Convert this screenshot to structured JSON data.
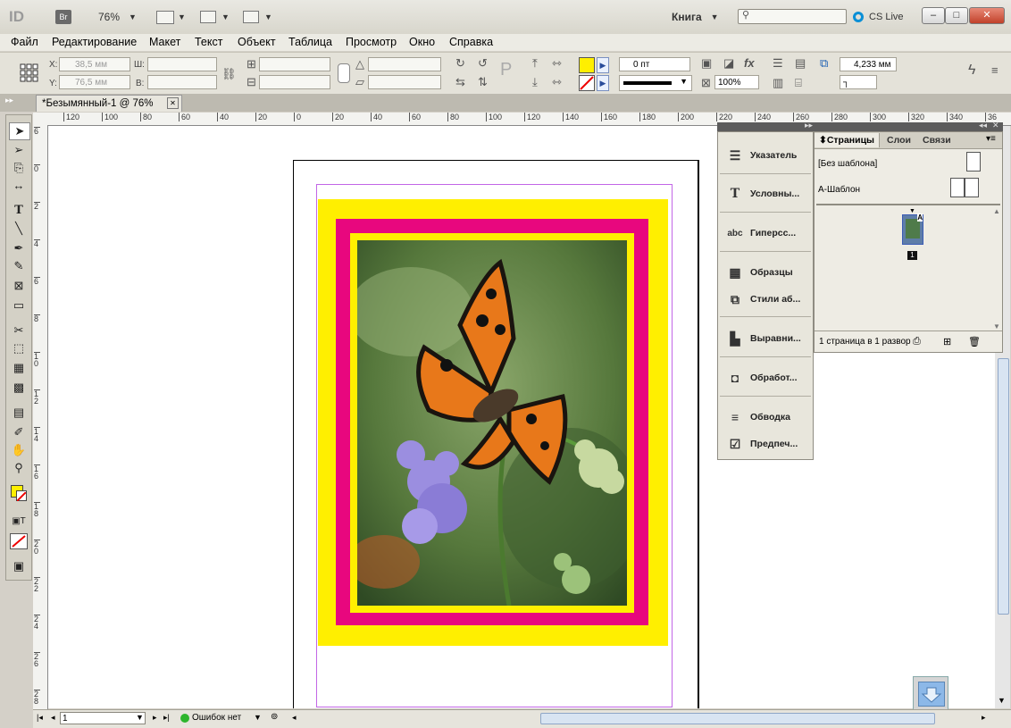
{
  "titlebar": {
    "app_logo": "ID",
    "bridge": "Br",
    "zoom": "76%",
    "workspace": "Книга",
    "search_placeholder": "",
    "cs_live": "CS Live",
    "minimize": "–",
    "maximize": "□",
    "close": "✕"
  },
  "menu": [
    "Файл",
    "Редактирование",
    "Макет",
    "Текст",
    "Объект",
    "Таблица",
    "Просмотр",
    "Окно",
    "Справка"
  ],
  "control": {
    "x_label": "X:",
    "x_value": "38,5 мм",
    "y_label": "Y:",
    "y_value": "76,5 мм",
    "w_label": "Ш:",
    "h_label": "В:",
    "stroke_weight": "0 пт",
    "opacity": "100%",
    "offset": "4,233 мм",
    "fill_color": "#ffef00"
  },
  "document": {
    "tab_title": "*Безымянный-1 @ 76%",
    "tab_close": "✕"
  },
  "ruler_h": [
    "120",
    "100",
    "80",
    "60",
    "40",
    "20",
    "0",
    "20",
    "40",
    "60",
    "80",
    "100",
    "120",
    "140",
    "160",
    "180",
    "200",
    "220",
    "240",
    "260",
    "280",
    "300",
    "320",
    "340",
    "36"
  ],
  "ruler_v": [
    "6",
    "0",
    "2",
    "4",
    "6",
    "8",
    "1 0",
    "1 2",
    "1 4",
    "1 6",
    "1 8",
    "2 0",
    "2 2",
    "2 4",
    "2 6",
    "2 8"
  ],
  "panels": {
    "icon_items": [
      "Указатель",
      "Условны...",
      "Гиперсс...",
      "Образцы",
      "Стили аб...",
      "Выравни...",
      "Обработ...",
      "Обводка",
      "Предпеч..."
    ],
    "pages_tabs": [
      "Страницы",
      "Слои",
      "Связи"
    ],
    "no_master": "[Без шаблона]",
    "master_a": "А-Шаблон",
    "page_letter": "A",
    "page_number": "1",
    "footer": "1 страница в 1 развор"
  },
  "status": {
    "page_field": "1",
    "errors": "Ошибок нет"
  },
  "colors": {
    "yellow": "#ffef00",
    "magenta": "#e8077e",
    "margin": "#c266e6"
  }
}
